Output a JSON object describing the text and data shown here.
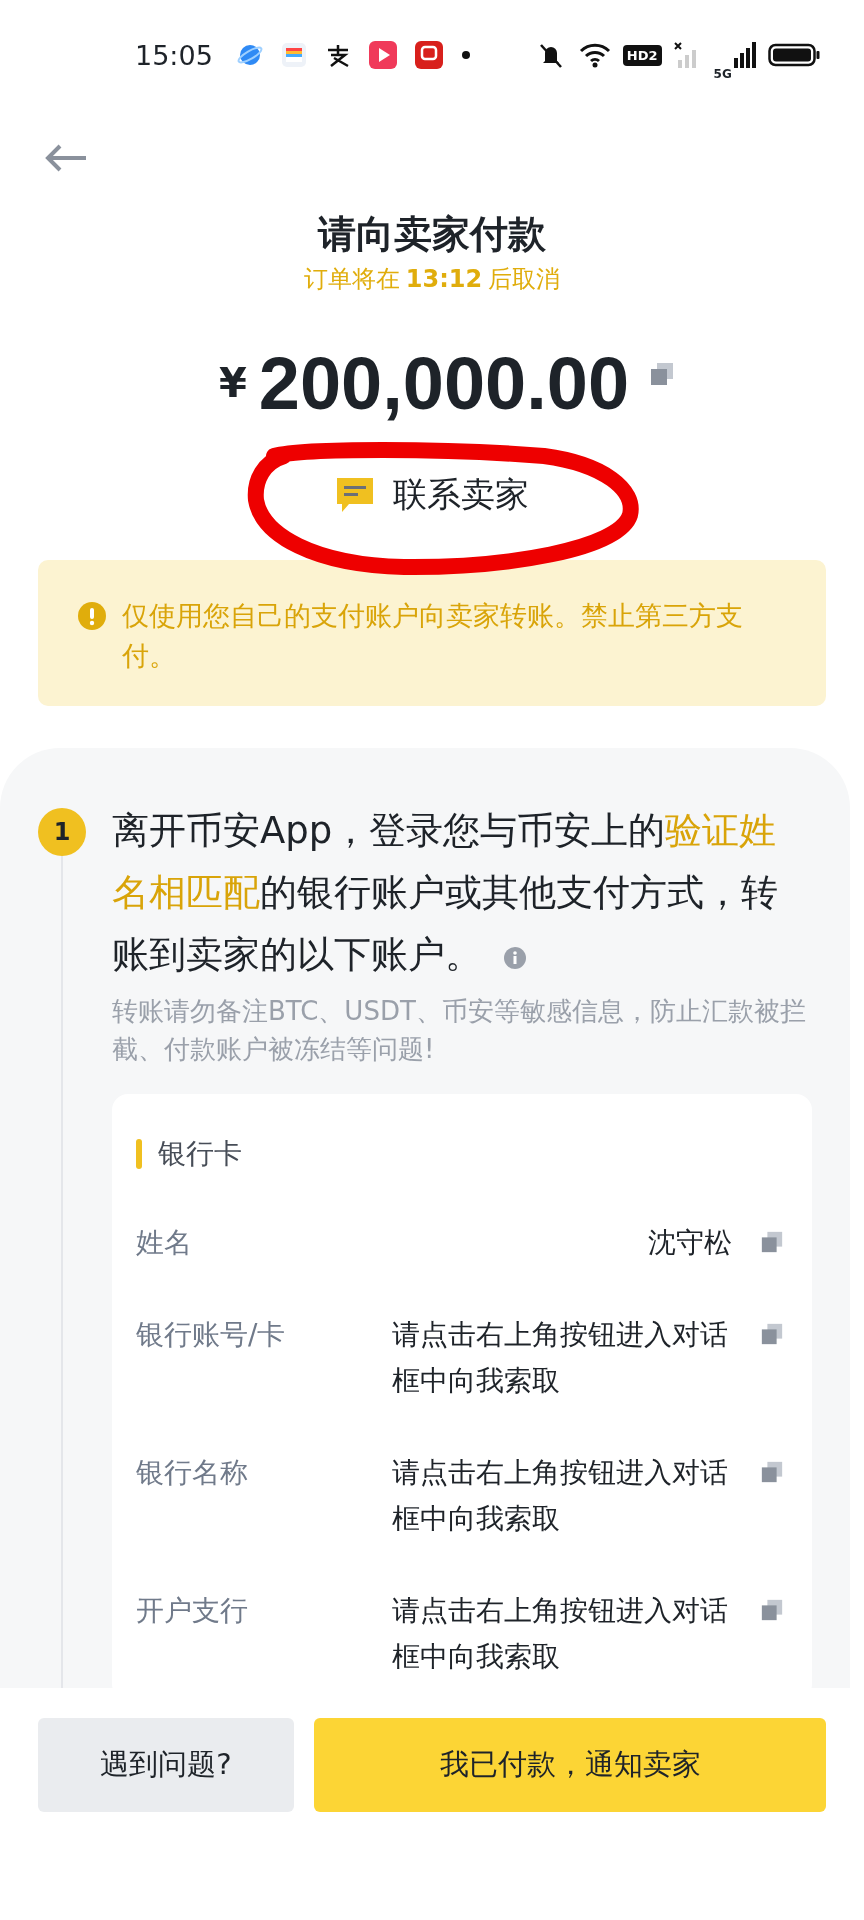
{
  "status_bar": {
    "time": "15:05",
    "hd_label": "HD2",
    "network_label": "5G"
  },
  "header": {
    "title": "请向卖家付款",
    "countdown_prefix": "订单将在",
    "countdown": "13:12",
    "countdown_suffix": "后取消"
  },
  "amount": {
    "currency": "¥",
    "value": "200,000.00"
  },
  "contact": {
    "label": "联系卖家"
  },
  "warning": {
    "text": "仅使用您自己的支付账户向卖家转账。禁止第三方支付。"
  },
  "step": {
    "number": "1",
    "parts": [
      {
        "text": "离开币安App，登录您与币安上的",
        "highlight": false
      },
      {
        "text": "验证姓名相匹配",
        "highlight": true
      },
      {
        "text": "的银行账户或其他支付方式，转账到卖家的以下账户。",
        "highlight": false
      }
    ],
    "note": "转账请勿备注BTC、USDT、币安等敏感信息，防止汇款被拦截、付款账户被冻结等问题!"
  },
  "card": {
    "title": "银行卡",
    "rows": [
      {
        "label": "姓名",
        "value": "沈守松"
      },
      {
        "label": "银行账号/卡",
        "value": "请点击右上角按钮进入对话框中向我索取"
      },
      {
        "label": "银行名称",
        "value": "请点击右上角按钮进入对话框中向我索取"
      },
      {
        "label": "开户支行",
        "value": "请点击右上角按钮进入对话框中向我索取"
      }
    ]
  },
  "buttons": [
    {
      "label": "遇到问题?",
      "kind": "secondary"
    },
    {
      "label": "我已付款，通知卖家",
      "kind": "primary"
    }
  ]
}
